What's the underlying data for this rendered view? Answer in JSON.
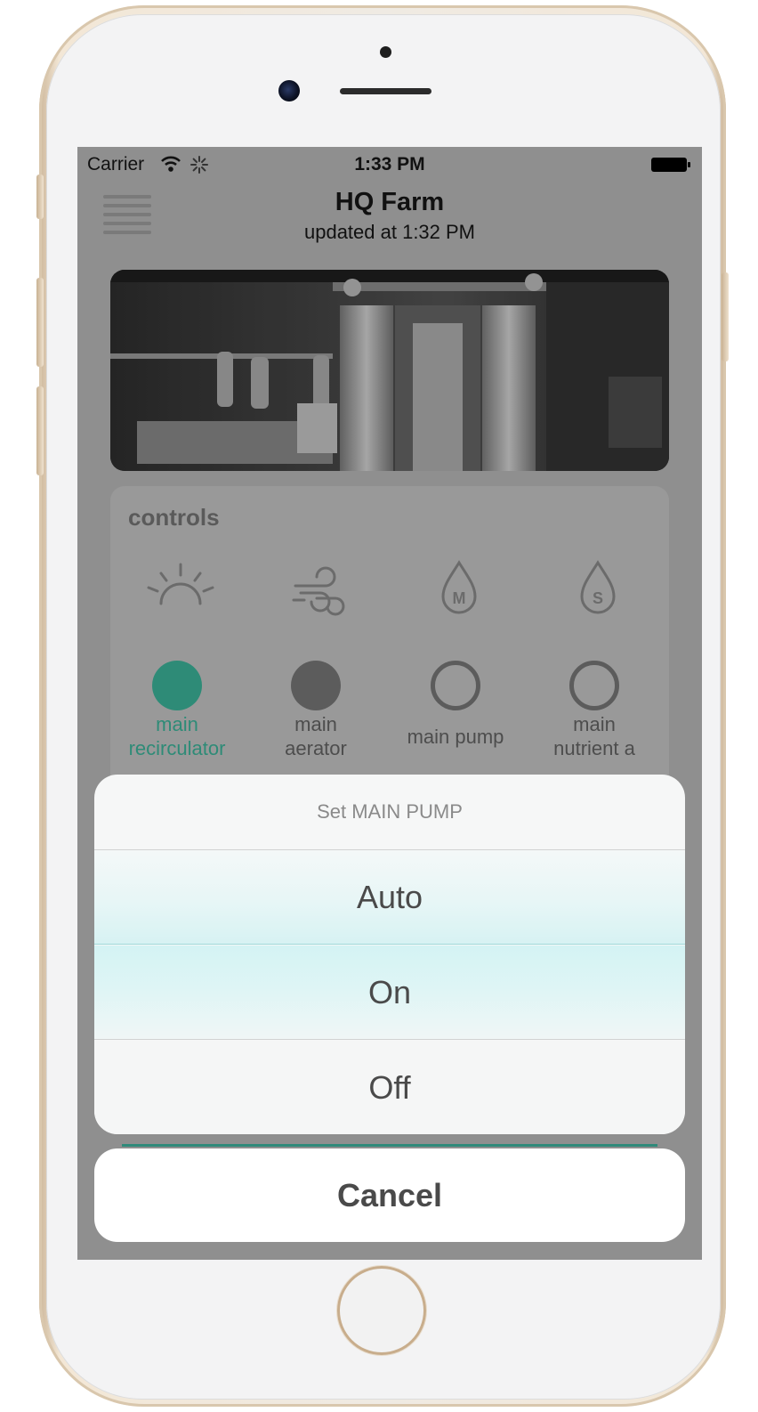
{
  "status_bar": {
    "carrier": "Carrier",
    "time": "1:33 PM"
  },
  "header": {
    "title": "HQ Farm",
    "subtitle": "updated at 1:32 PM"
  },
  "controls": {
    "title": "controls",
    "icons": [
      "sun-icon",
      "wind-icon",
      "drop-m-icon",
      "drop-s-icon"
    ],
    "toggles": [
      {
        "label": "main\nrecirculator",
        "state": "on-teal",
        "color": "#2e8b77"
      },
      {
        "label": "main\naerator",
        "state": "on-dark",
        "color": "#5c5c5c"
      },
      {
        "label": "main pump",
        "state": "off",
        "color": "#5c5c5c"
      },
      {
        "label": "main\nnutrient a",
        "state": "off",
        "color": "#5c5c5c"
      }
    ]
  },
  "action_sheet": {
    "title": "Set MAIN PUMP",
    "options": [
      "Auto",
      "On",
      "Off"
    ],
    "cancel": "Cancel"
  },
  "colors": {
    "accent": "#2e8b77",
    "overlay": "#8f8f8f"
  }
}
